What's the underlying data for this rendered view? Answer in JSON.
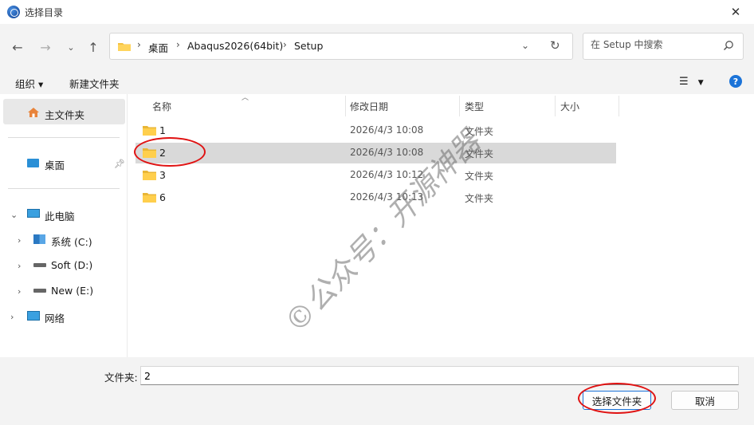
{
  "window": {
    "title": "选择目录",
    "close_icon": "close-icon"
  },
  "nav": {
    "back_icon": "arrow-left-icon",
    "forward_icon": "arrow-right-icon",
    "recent_icon": "chevron-down-icon",
    "up_icon": "arrow-up-icon",
    "breadcrumbs": [
      "桌面",
      "Abaqus2026(64bit)",
      "Setup"
    ],
    "search_placeholder": "在 Setup 中搜索"
  },
  "toolbar": {
    "organize_label": "组织 ▾",
    "new_folder_label": "新建文件夹"
  },
  "sidebar": {
    "home_label": "主文件夹",
    "desktop_label": "桌面",
    "pc_label": "此电脑",
    "drives": [
      "系统 (C:)",
      "Soft (D:)",
      "New (E:)"
    ],
    "network_label": "网络"
  },
  "columns": {
    "name": "名称",
    "modified": "修改日期",
    "type": "类型",
    "size": "大小"
  },
  "files": [
    {
      "name": "1",
      "modified": "2026/4/3 10:08",
      "type": "文件夹"
    },
    {
      "name": "2",
      "modified": "2026/4/3 10:08",
      "type": "文件夹"
    },
    {
      "name": "3",
      "modified": "2026/4/3 10:12",
      "type": "文件夹"
    },
    {
      "name": "6",
      "modified": "2026/4/3 10:13",
      "type": "文件夹"
    }
  ],
  "selected_file": "2",
  "bottom": {
    "folder_label": "文件夹:",
    "folder_value": "2",
    "select_label": "选择文件夹",
    "cancel_label": "取消"
  },
  "watermark": "©公众号：开源神器",
  "colors": {
    "accent": "#1b73d8",
    "folder": "#f4c242",
    "annotation": "#e01212"
  }
}
